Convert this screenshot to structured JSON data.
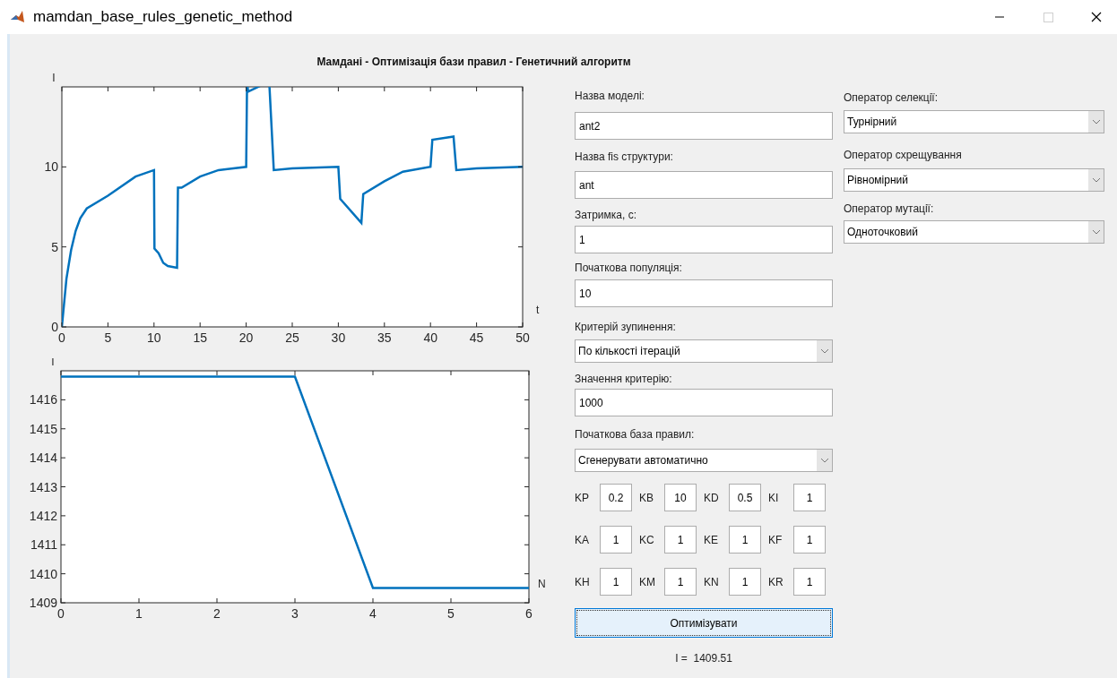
{
  "window": {
    "title": "mamdan_base_rules_genetic_method"
  },
  "plot_title": "Мамдані - Оптимізація бази правил - Генетичний алгоритм",
  "charts": [
    {
      "chart_data": {
        "type": "line",
        "ylabel": "I",
        "xlabel": "t",
        "x": [
          0,
          0.5,
          1,
          1.5,
          2,
          2.7,
          5,
          8,
          10,
          10.05,
          10.5,
          11,
          11.5,
          12.5,
          12.6,
          13,
          15,
          17,
          20,
          20.1,
          20.2,
          22.5,
          23,
          25,
          30,
          30.2,
          32.5,
          32.7,
          35,
          37,
          40,
          40.2,
          42.5,
          42.8,
          45,
          50
        ],
        "series": [
          {
            "color": "#0072bd",
            "values": [
              0,
              3,
              4.8,
              6,
              6.8,
              7.4,
              8.2,
              9.4,
              9.8,
              4.9,
              4.6,
              4,
              3.8,
              3.7,
              8.7,
              8.7,
              9.4,
              9.8,
              10,
              null,
              14.7,
              null,
              9.8,
              9.9,
              10,
              8,
              6.5,
              8.3,
              9.1,
              9.7,
              10,
              11.7,
              11.9,
              9.8,
              9.9,
              10
            ]
          }
        ],
        "xlim": [
          0,
          50
        ],
        "ylim": [
          0,
          15
        ],
        "xticks": [
          0,
          5,
          10,
          15,
          20,
          25,
          30,
          35,
          40,
          45,
          50
        ],
        "yticks": [
          0,
          5,
          10
        ]
      }
    },
    {
      "chart_data": {
        "type": "line",
        "ylabel": "I",
        "xlabel": "N",
        "x": [
          0,
          1,
          2,
          3,
          4,
          5,
          6
        ],
        "series": [
          {
            "color": "#0072bd",
            "values": [
              1416.8,
              1416.8,
              1416.8,
              1416.8,
              1409.51,
              1409.51,
              1409.51
            ]
          }
        ],
        "xlim": [
          0,
          6
        ],
        "ylim": [
          1409,
          1417
        ],
        "xticks": [
          0,
          1,
          2,
          3,
          4,
          5,
          6
        ],
        "yticks": [
          1409,
          1410,
          1411,
          1412,
          1413,
          1414,
          1415,
          1416
        ]
      }
    }
  ],
  "form": {
    "fields": [
      {
        "kind": "text",
        "label": "Назва моделі:",
        "value": "ant2"
      },
      {
        "kind": "text",
        "label": "Назва fis структури:",
        "value": "ant"
      },
      {
        "kind": "text",
        "label": "Затримка, с:",
        "value": "1"
      },
      {
        "kind": "text",
        "label": "Початкова популяція:",
        "value": "10"
      },
      {
        "kind": "combo",
        "label": "Критерій зупинення:",
        "value": "По кількості ітерацій"
      },
      {
        "kind": "text",
        "label": "Значення критерію:",
        "value": "1000"
      },
      {
        "kind": "combo",
        "label": "Початкова база правил:",
        "value": "Сгенерувати автоматично"
      }
    ],
    "coefficients": [
      {
        "label": "KP",
        "value": "0.2"
      },
      {
        "label": "KB",
        "value": "10"
      },
      {
        "label": "KD",
        "value": "0.5"
      },
      {
        "label": "KI",
        "value": "1"
      },
      {
        "label": "KA",
        "value": "1"
      },
      {
        "label": "KC",
        "value": "1"
      },
      {
        "label": "KE",
        "value": "1"
      },
      {
        "label": "KF",
        "value": "1"
      },
      {
        "label": "KH",
        "value": "1"
      },
      {
        "label": "KM",
        "value": "1"
      },
      {
        "label": "KN",
        "value": "1"
      },
      {
        "label": "KR",
        "value": "1"
      }
    ],
    "button": "Оптимізувати",
    "result": "I =  1409.51"
  },
  "operators": [
    {
      "kind": "combo",
      "label": "Оператор селекції:",
      "value": "Турнірний"
    },
    {
      "kind": "combo",
      "label": "Оператор схрещування",
      "value": "Рівномірний"
    },
    {
      "kind": "combo",
      "label": "Оператор мутації:",
      "value": "Одноточковий"
    }
  ]
}
